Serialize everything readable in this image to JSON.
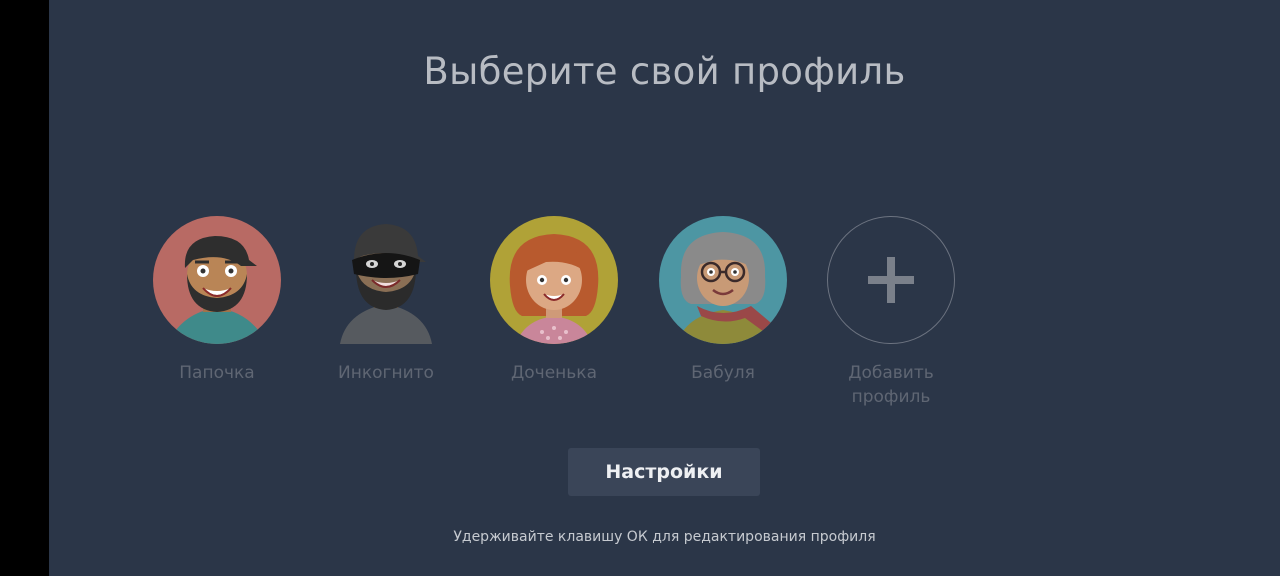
{
  "title": "Выберите свой профиль",
  "profiles": [
    {
      "name": "Папочка",
      "avatar": "father-avatar",
      "bg": "#b86a64"
    },
    {
      "name": "Инкогнито",
      "avatar": "incognito-avatar",
      "bg": "#2b3648"
    },
    {
      "name": "Доченька",
      "avatar": "daughter-avatar",
      "bg": "#b0a237"
    },
    {
      "name": "Бабуля",
      "avatar": "grandma-avatar",
      "bg": "#4d96a3"
    }
  ],
  "add_profile": {
    "label_line1": "Добавить",
    "label_line2": "профиль",
    "icon": "plus-icon"
  },
  "settings_button": "Настройки",
  "hint": "Удерживайте клавишу ОК для редактирования профиля"
}
